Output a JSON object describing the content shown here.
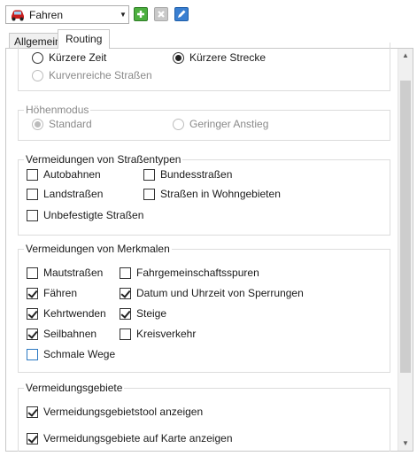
{
  "toolbar": {
    "profile_value": "Fahren",
    "profile_icon": "car-icon",
    "add_icon": "add-icon",
    "delete_icon": "delete-icon",
    "edit_icon": "edit-icon"
  },
  "tabs": [
    {
      "label": "Allgemein",
      "active": false
    },
    {
      "label": "Routing",
      "active": true
    }
  ],
  "route_type": {
    "options": [
      {
        "label": "Kürzere Zeit",
        "selected": false,
        "enabled": true
      },
      {
        "label": "Kürzere Strecke",
        "selected": true,
        "enabled": true
      },
      {
        "label": "Kurvenreiche Straßen",
        "selected": false,
        "enabled": false
      }
    ]
  },
  "hoehenmodus": {
    "title": "Höhenmodus",
    "options": [
      {
        "label": "Standard",
        "selected": true,
        "enabled": false
      },
      {
        "label": "Geringer Anstieg",
        "selected": false,
        "enabled": false
      }
    ]
  },
  "strassentypen": {
    "title": "Vermeidungen von Straßentypen",
    "items": [
      {
        "label": "Autobahnen",
        "checked": false
      },
      {
        "label": "Bundesstraßen",
        "checked": false
      },
      {
        "label": "Landstraßen",
        "checked": false
      },
      {
        "label": "Straßen in Wohngebieten",
        "checked": false
      },
      {
        "label": "Unbefestigte Straßen",
        "checked": false
      }
    ]
  },
  "merkmale": {
    "title": "Vermeidungen von Merkmalen",
    "items": [
      {
        "label": "Mautstraßen",
        "checked": false
      },
      {
        "label": "Fahrgemeinschaftsspuren",
        "checked": false
      },
      {
        "label": "Fähren",
        "checked": true
      },
      {
        "label": "Datum und Uhrzeit von Sperrungen",
        "checked": true
      },
      {
        "label": "Kehrtwenden",
        "checked": true
      },
      {
        "label": "Steige",
        "checked": true
      },
      {
        "label": "Seilbahnen",
        "checked": true
      },
      {
        "label": "Kreisverkehr",
        "checked": false
      },
      {
        "label": "Schmale Wege",
        "checked": false
      }
    ]
  },
  "gebiete": {
    "title": "Vermeidungsgebiete",
    "items": [
      {
        "label": "Vermeidungsgebietstool anzeigen",
        "checked": true
      },
      {
        "label": "Vermeidungsgebiete auf Karte anzeigen",
        "checked": true
      }
    ]
  }
}
